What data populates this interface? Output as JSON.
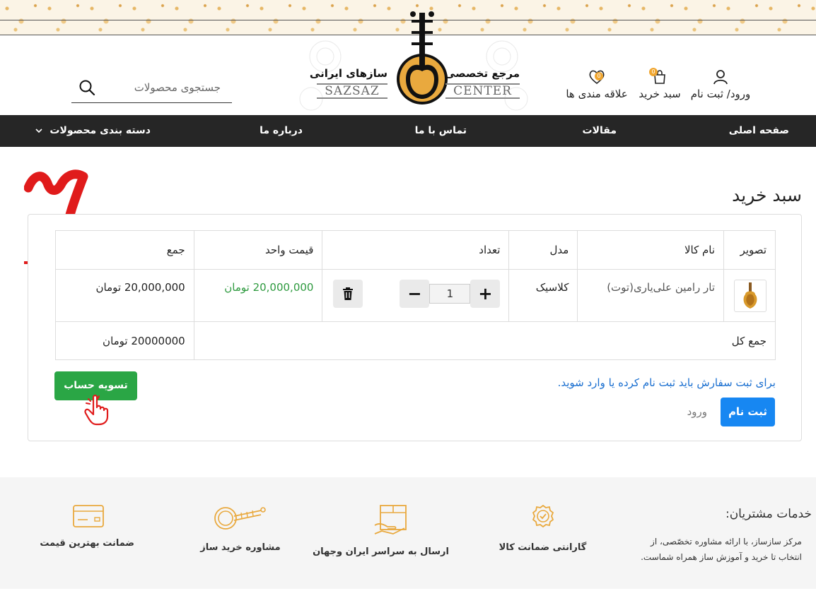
{
  "header": {
    "account_label": "ورود/ ثبت نام",
    "cart_label": "سبد خرید",
    "cart_count": "0",
    "wishlist_label": "علاقه مندی ها",
    "wishlist_count": "0",
    "search_placeholder": "جستجوی محصولات",
    "logo": {
      "title": "مرجع تخصصی",
      "subtitle": "سازهای ایرانی",
      "latin_left": "SAZSAZ",
      "latin_right": "CENTER"
    }
  },
  "nav": {
    "home": "صفحه اصلی",
    "articles": "مقالات",
    "contact": "تماس با ما",
    "about": "درباره ما",
    "categories": "دسته بندی محصولات"
  },
  "annotation": {
    "step_number": "۷"
  },
  "cart": {
    "title": "سبد خرید",
    "columns": {
      "image": "تصویر",
      "name": "نام کالا",
      "model": "مدل",
      "quantity": "تعداد",
      "unit_price": "قیمت واحد",
      "total": "جمع"
    },
    "items": [
      {
        "name": "تار رامین علی‌یاری(توت)",
        "model": "کلاسیک",
        "quantity": "1",
        "unit_price": "20,000,000 تومان",
        "total": "20,000,000 تومان"
      }
    ],
    "grand_total_label": "جمع کل",
    "grand_total_value": "20000000 تومان",
    "checkout_label": "تسویه حساب",
    "login_message": "برای ثبت سفارش باید ثبت نام کرده یا وارد شوید.",
    "register_label": "ثبت نام",
    "login_label": "ورود"
  },
  "footer": {
    "services_title": "خدمات مشتریان:",
    "services_desc": "مرکز سازساز، با ارائه مشاوره تخصّصی، از انتخاب تا خرید و آموزش ساز همراه شماست.",
    "features": [
      "گارانتی ضمانت کالا",
      "ارسال به سراسر ایران وجهان",
      "مشاوره خرید ساز",
      "ضمانت بهترین قیمت"
    ]
  },
  "colors": {
    "nav_bg": "#262626",
    "accent_gold": "#e9a93e",
    "green": "#2aa645",
    "blue": "#1787f2",
    "red_annotation": "#e01b1b"
  }
}
